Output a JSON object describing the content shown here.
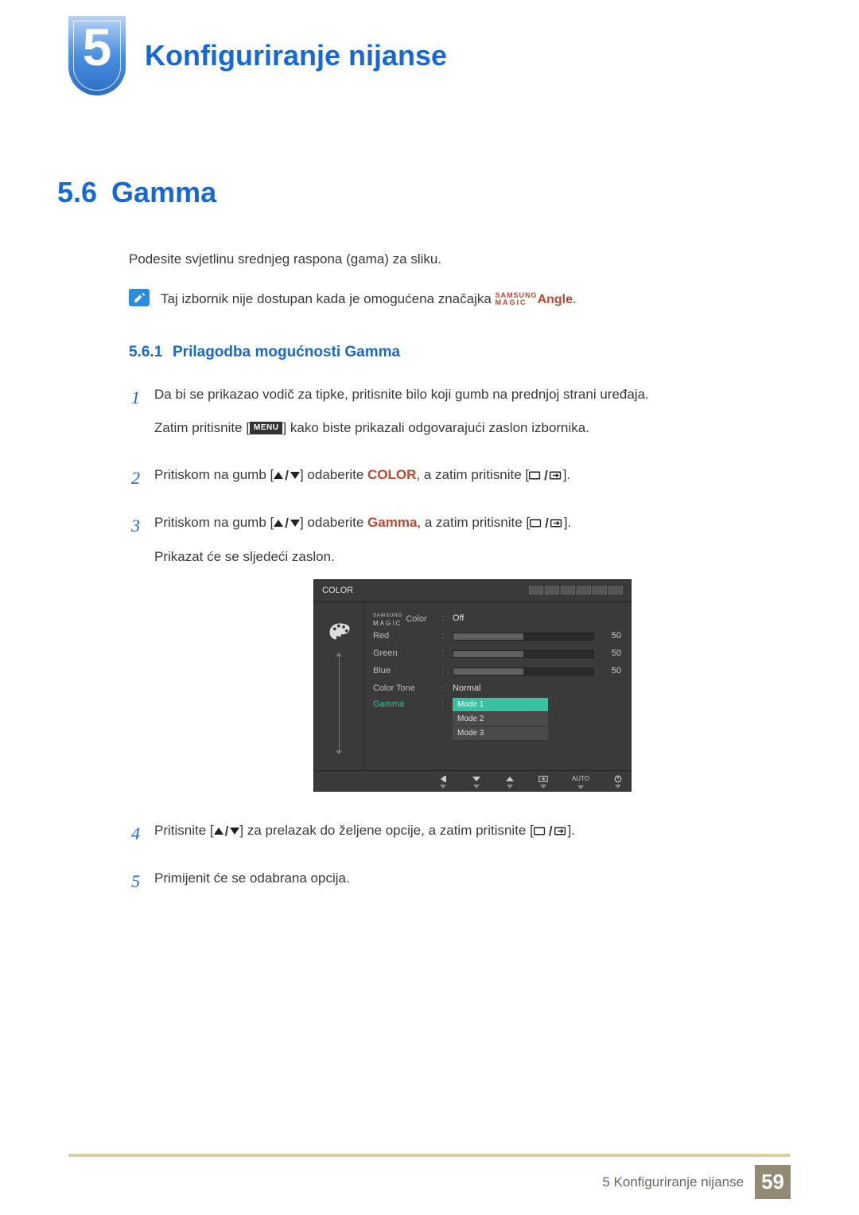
{
  "chapter": {
    "number": "5",
    "title": "Konfiguriranje nijanse"
  },
  "section": {
    "number": "5.6",
    "title": "Gamma"
  },
  "intro": "Podesite svjetlinu srednjeg raspona (gama) za sliku.",
  "note": {
    "prefix": "Taj izbornik nije dostupan kada je omogućena značajka ",
    "magic_top": "SAMSUNG",
    "magic_bottom": "MAGIC",
    "magic_word": "Angle",
    "suffix": "."
  },
  "subsection": {
    "number": "5.6.1",
    "title": "Prilagodba mogućnosti Gamma"
  },
  "steps": {
    "s1": {
      "num": "1",
      "line1": "Da bi se prikazao vodič za tipke, pritisnite bilo koji gumb na prednjoj strani uređaja.",
      "line2a": "Zatim pritisnite [",
      "menu": "MENU",
      "line2b": "] kako biste prikazali odgovarajući zaslon izbornika."
    },
    "s2": {
      "num": "2",
      "a": "Pritiskom na gumb [",
      "b": "] odaberite ",
      "color": "COLOR",
      "c": ", a zatim pritisnite [",
      "d": "]."
    },
    "s3": {
      "num": "3",
      "a": "Pritiskom na gumb [",
      "b": "] odaberite ",
      "gamma": "Gamma",
      "c": ", a zatim pritisnite [",
      "d": "].",
      "e": "Prikazat će se sljedeći zaslon."
    },
    "s4": {
      "num": "4",
      "a": "Pritisnite [",
      "b": "] za prelazak do željene opcije, a zatim pritisnite [",
      "c": "]."
    },
    "s5": {
      "num": "5",
      "text": "Primijenit će se odabrana opcija."
    }
  },
  "osd": {
    "title": "COLOR",
    "rows": {
      "magic": {
        "label": "Color",
        "value": "Off"
      },
      "red": {
        "label": "Red",
        "value": "",
        "num": "50"
      },
      "green": {
        "label": "Green",
        "value": "",
        "num": "50"
      },
      "blue": {
        "label": "Blue",
        "value": "",
        "num": "50"
      },
      "tone": {
        "label": "Color Tone",
        "value": "Normal"
      },
      "gamma": {
        "label": "Gamma"
      }
    },
    "modes": {
      "m1": "Mode 1",
      "m2": "Mode 2",
      "m3": "Mode 3"
    },
    "auto": "AUTO"
  },
  "footer": {
    "text": "5 Konfiguriranje nijanse",
    "page": "59"
  }
}
